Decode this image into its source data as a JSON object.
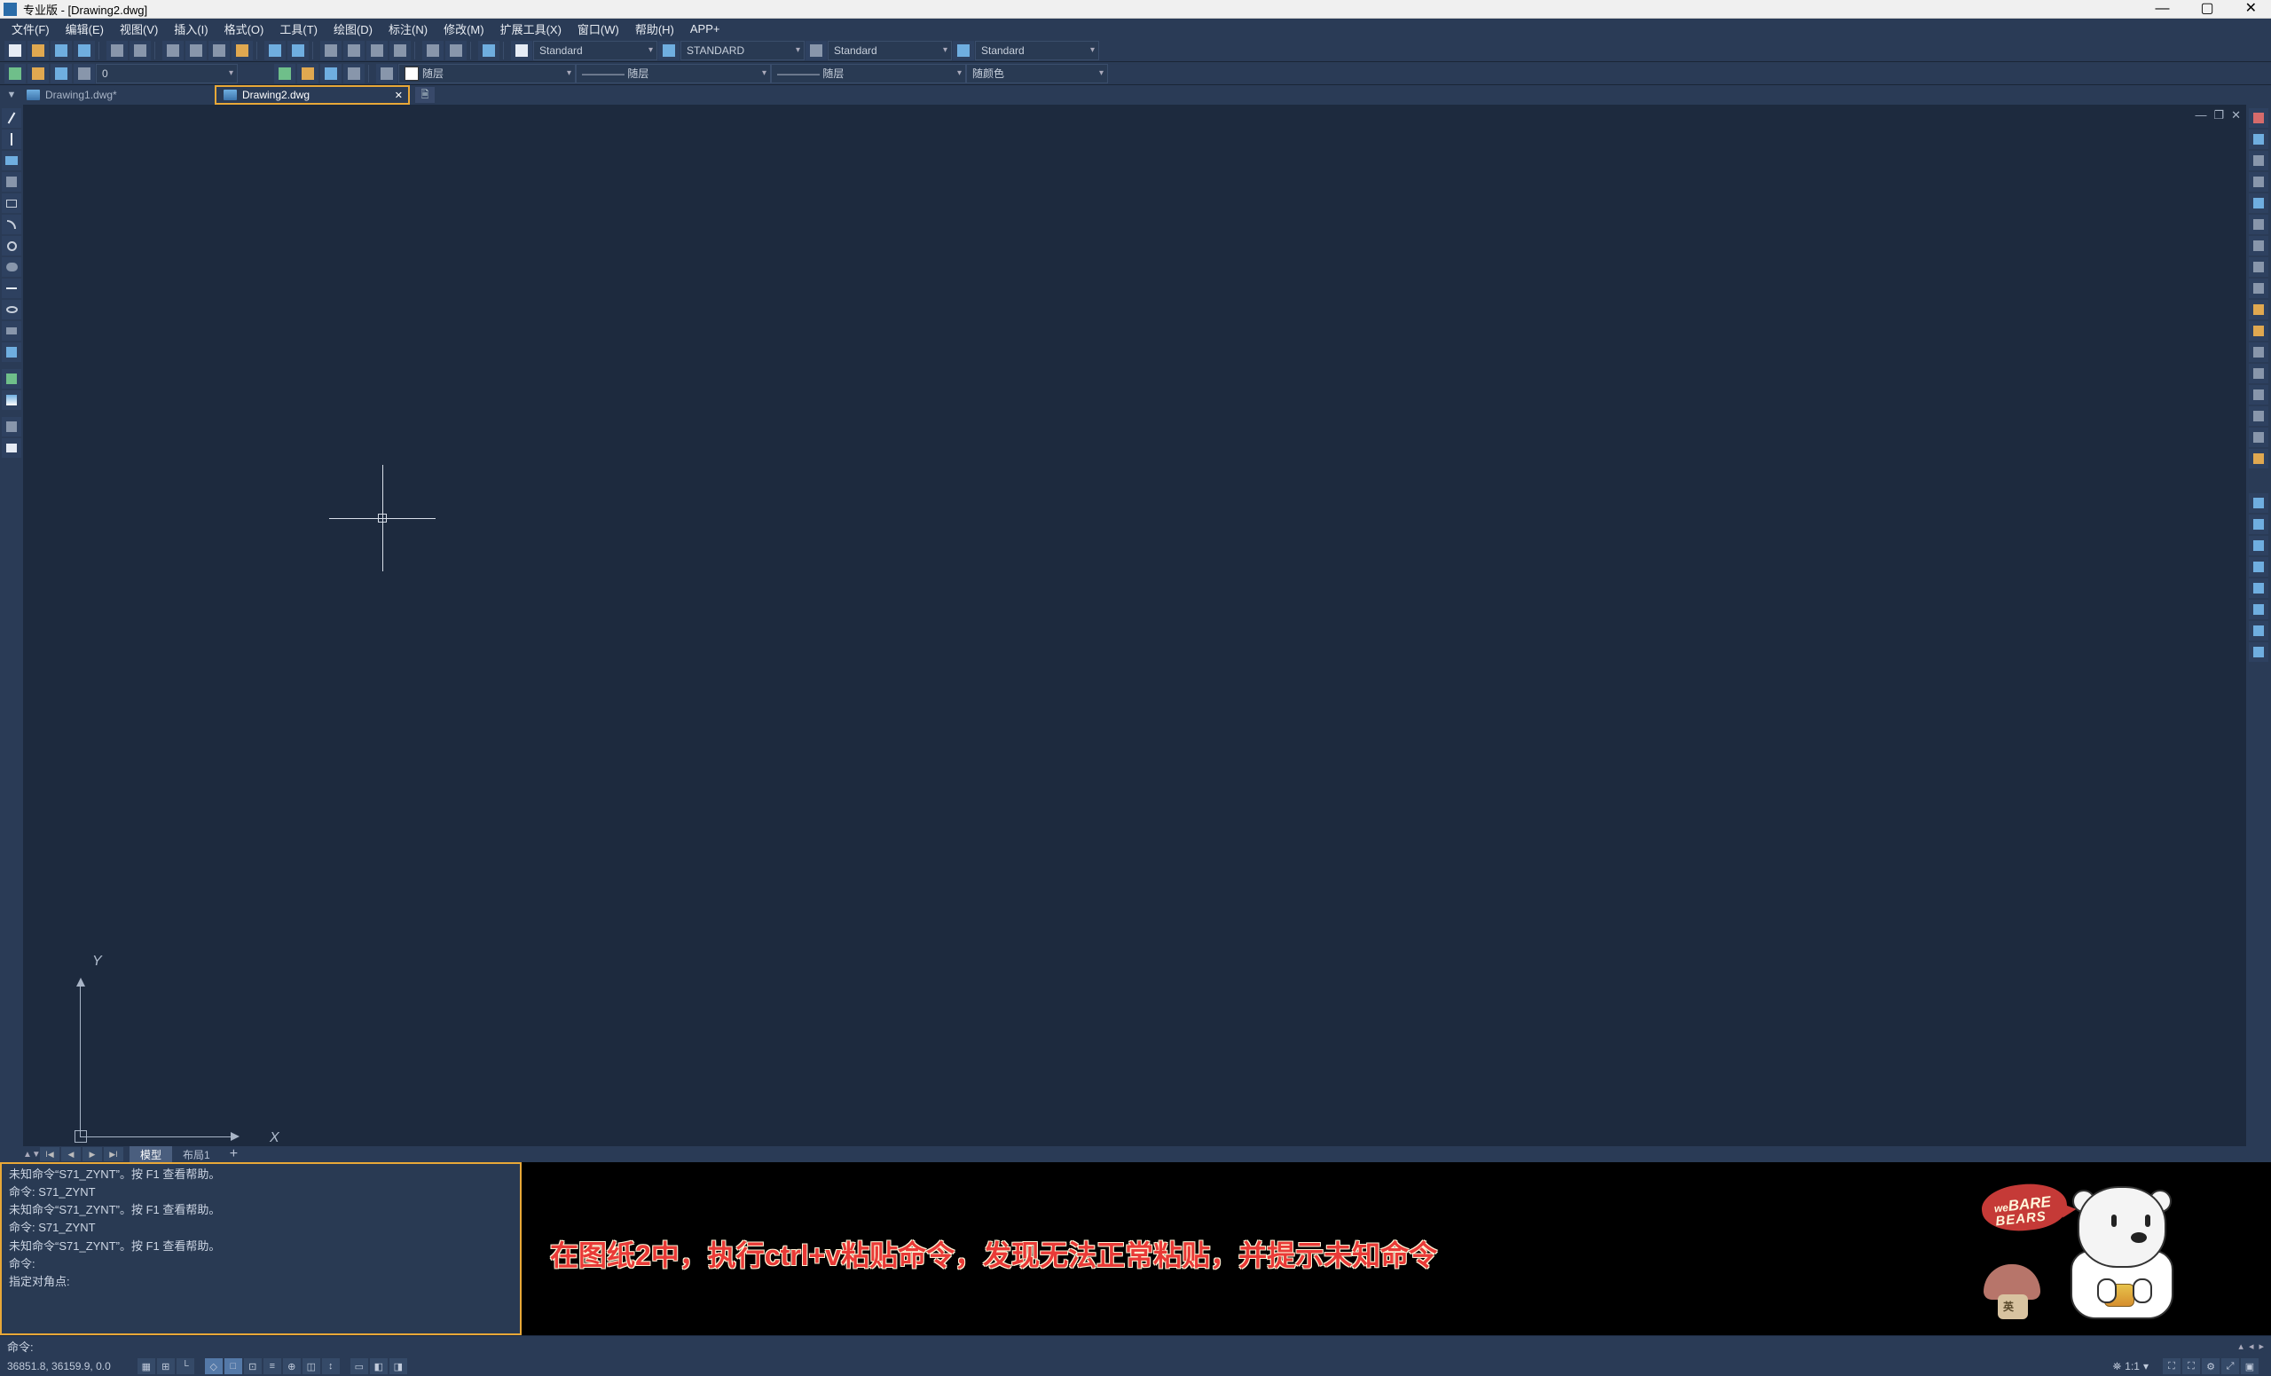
{
  "title": "专业版 - [Drawing2.dwg]",
  "menu": {
    "file": "文件(F)",
    "edit": "编辑(E)",
    "view": "视图(V)",
    "insert": "插入(I)",
    "format": "格式(O)",
    "tools": "工具(T)",
    "draw": "绘图(D)",
    "dimension": "标注(N)",
    "modify": "修改(M)",
    "ext": "扩展工具(X)",
    "window": "窗口(W)",
    "help": "帮助(H)",
    "app": "APP+"
  },
  "dropdowns": {
    "textStyle": "Standard",
    "dimStyle": "STANDARD",
    "tableStyle": "Standard",
    "mleaderStyle": "Standard",
    "layer1": "随层",
    "layer2": "———— 随层",
    "layer3": "———— 随层",
    "color": "随颜色"
  },
  "tabs": {
    "t1": "Drawing1.dwg*",
    "t2": "Drawing2.dwg"
  },
  "ucs": {
    "x": "X",
    "y": "Y"
  },
  "layoutTabs": {
    "model": "模型",
    "layout1": "布局1"
  },
  "cmd": {
    "log": [
      "未知命令“S71_ZYNT”。按 F1 查看帮助。",
      "命令: S71_ZYNT",
      "未知命令“S71_ZYNT”。按 F1 查看帮助。",
      "命令: S71_ZYNT",
      "未知命令“S71_ZYNT”。按 F1 查看帮助。",
      "命令:",
      "指定对角点:"
    ],
    "prompt": "命令:"
  },
  "status": {
    "coords": "36851.8, 36159.9, 0.0",
    "scale": "1:1"
  },
  "annotation": "在图纸2中，执行ctrl+v粘贴命令，发现无法正常粘贴，并提示未知命令",
  "mascot": {
    "bubble1": "we",
    "bubble2": "BARE",
    "bubble3": "BEARS",
    "mushroom": "英"
  }
}
